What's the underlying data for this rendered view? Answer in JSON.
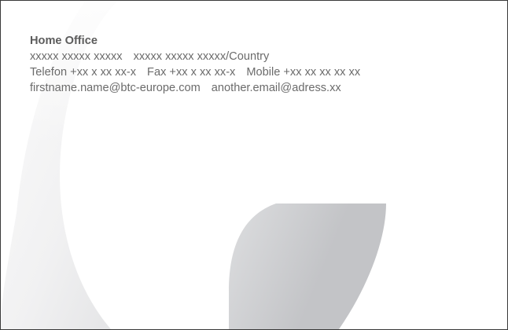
{
  "heading": "Home Office",
  "address": {
    "street": "xxxxx xxxxx xxxxx",
    "city": "xxxxx xxxxx xxxxx/Country"
  },
  "phones": {
    "telefon": "Telefon +xx x xx xx-x",
    "fax": "Fax +xx x xx xx-x",
    "mobile": "Mobile +xx xx xx xx xx"
  },
  "emails": {
    "primary": "firstname.name@btc-europe.com",
    "secondary": "another.email@adress.xx"
  },
  "colors": {
    "text": "#6b6b6b",
    "swoosh_light": "#f7f7f8",
    "swoosh_dark": "#bfc0c3",
    "border": "#3a3a3a"
  }
}
